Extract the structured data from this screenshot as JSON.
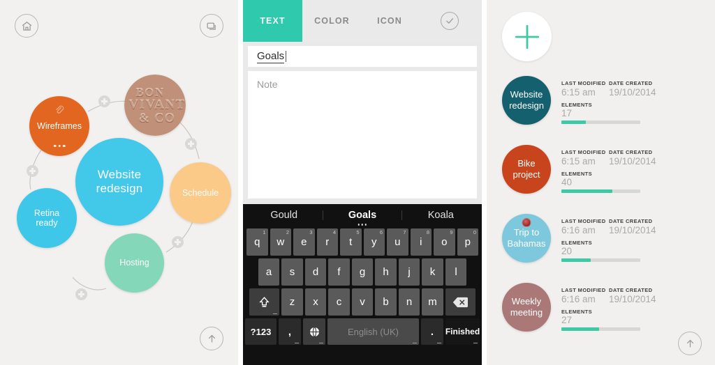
{
  "panels": {
    "mindmap": {
      "home_label": "Home",
      "cards_label": "Cards",
      "up_label": "Scroll up",
      "nodes": [
        {
          "id": "center",
          "label": "Website redesign",
          "color": "#42c8e8",
          "type": "bubble"
        },
        {
          "id": "wireframes",
          "label": "Wireframes",
          "color": "#e2661f",
          "type": "bubble",
          "has_attachment": true,
          "has_more": true
        },
        {
          "id": "photo",
          "label": "BON VIVANT & CO",
          "color": "#c09078",
          "type": "photo",
          "photo_lines": [
            "BON",
            "VIVANT",
            "& CO"
          ]
        },
        {
          "id": "schedule",
          "label": "Schedule",
          "color": "#fbc988",
          "type": "bubble"
        },
        {
          "id": "hosting",
          "label": "Hosting",
          "color": "#84d7b8",
          "type": "bubble"
        },
        {
          "id": "retina",
          "label": "Retina ready",
          "color": "#3ec7e8",
          "type": "bubble",
          "line1": "Retina",
          "line2": "ready"
        }
      ],
      "center_line1": "Website",
      "center_line2": "redesign",
      "add_link_label": "+"
    },
    "editor": {
      "tabs": [
        {
          "key": "text",
          "label": "TEXT",
          "active": true
        },
        {
          "key": "color",
          "label": "COLOR",
          "active": false
        },
        {
          "key": "icon",
          "label": "ICON",
          "active": false
        }
      ],
      "confirm_label": "Done",
      "title_value": "Goals",
      "title_placeholder": "Title",
      "note_value": "",
      "note_placeholder": "Note"
    },
    "keyboard": {
      "suggestions": [
        "Gould",
        "Goals",
        "Koala"
      ],
      "selected_suggestion_index": 1,
      "row1": [
        {
          "k": "q",
          "n": "1"
        },
        {
          "k": "w",
          "n": "2"
        },
        {
          "k": "e",
          "n": "3"
        },
        {
          "k": "r",
          "n": "4"
        },
        {
          "k": "t",
          "n": "5"
        },
        {
          "k": "y",
          "n": "6"
        },
        {
          "k": "u",
          "n": "7"
        },
        {
          "k": "i",
          "n": "8"
        },
        {
          "k": "o",
          "n": "9"
        },
        {
          "k": "p",
          "n": "0"
        }
      ],
      "row2": [
        "a",
        "s",
        "d",
        "f",
        "g",
        "h",
        "j",
        "k",
        "l"
      ],
      "row3": [
        "z",
        "x",
        "c",
        "v",
        "b",
        "n",
        "m"
      ],
      "shift_label": "Shift",
      "backspace_label": "Backspace",
      "symbols_label": "?123",
      "comma_label": ",",
      "globe_label": "Language",
      "space_label": "English (UK)",
      "period_label": ".",
      "finished_label": "Finished"
    },
    "projects": {
      "add_label": "New project",
      "up_label": "Scroll up",
      "col_last_modified": "LAST MODIFIED",
      "col_date_created": "DATE CREATED",
      "col_elements": "ELEMENTS",
      "items": [
        {
          "name": "Website redesign",
          "line1": "Website",
          "line2": "redesign",
          "color": "#15606e",
          "last_modified": "6:15 am",
          "date_created": "19/10/2014",
          "elements": "17",
          "progress": 31,
          "badge": false
        },
        {
          "name": "Bike project",
          "line1": "Bike",
          "line2": "project",
          "color": "#c8441c",
          "last_modified": "6:15 am",
          "date_created": "19/10/2014",
          "elements": "40",
          "progress": 65,
          "badge": false
        },
        {
          "name": "Trip to Bahamas",
          "line1": "Trip to",
          "line2": "Bahamas",
          "color": "#7ec8dd",
          "last_modified": "6:16 am",
          "date_created": "19/10/2014",
          "elements": "20",
          "progress": 37,
          "badge": true
        },
        {
          "name": "Weekly meeting",
          "line1": "Weekly",
          "line2": "meeting",
          "color": "#ab7878",
          "last_modified": "6:16 am",
          "date_created": "19/10/2014",
          "elements": "27",
          "progress": 48,
          "badge": false
        }
      ]
    }
  },
  "colors": {
    "accent_teal": "#2fc9ad",
    "progress_green": "#3dc9a5",
    "panel_bg": "#f1f0ee",
    "keyboard_bg": "#111111"
  }
}
